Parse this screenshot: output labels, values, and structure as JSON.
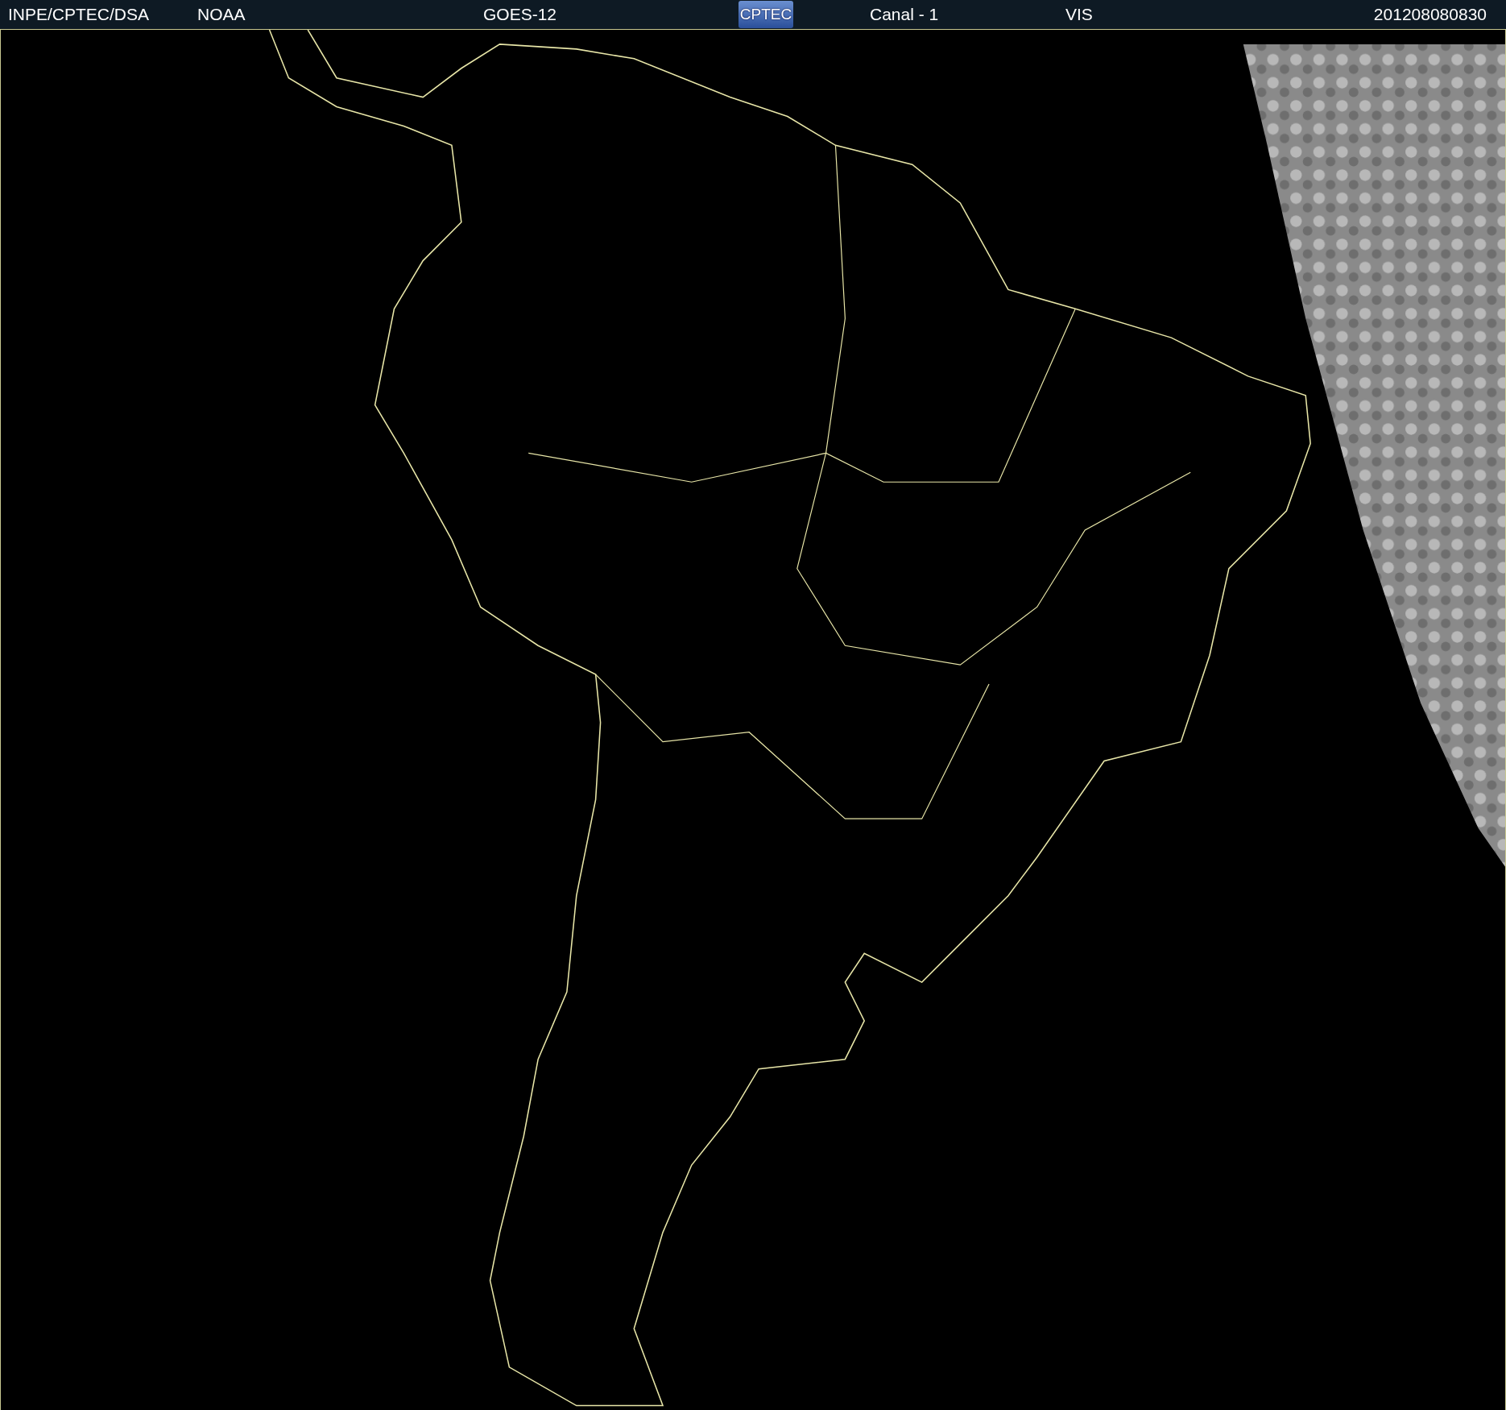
{
  "header": {
    "items": [
      {
        "kind": "text",
        "text": "INPE/CPTEC/DSA"
      },
      {
        "kind": "text",
        "text": "NOAA"
      },
      {
        "kind": "text",
        "text": "GOES-12"
      },
      {
        "kind": "logo",
        "text": "CPTEC"
      },
      {
        "kind": "text",
        "text": "Canal - 1"
      },
      {
        "kind": "text",
        "text": "VIS"
      },
      {
        "kind": "text",
        "text": "201208080830"
      }
    ]
  }
}
